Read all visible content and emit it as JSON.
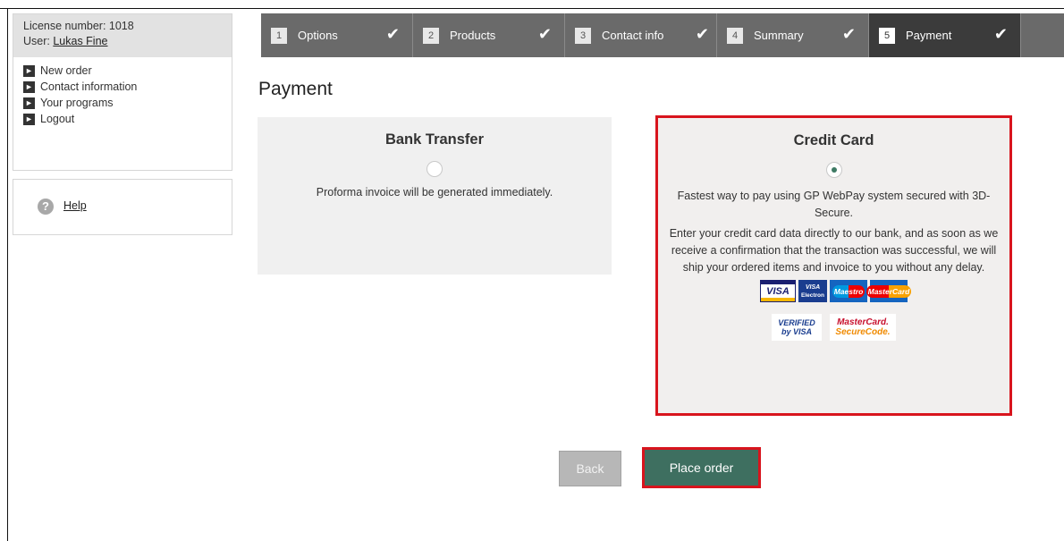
{
  "account": {
    "license_line": "License number: 1018",
    "user_prefix": "User: ",
    "user_name": "Lukas Fine"
  },
  "menu": {
    "items": [
      {
        "label": "New order"
      },
      {
        "label": "Contact information"
      },
      {
        "label": "Your programs"
      },
      {
        "label": "Logout"
      }
    ]
  },
  "help": {
    "label": "Help"
  },
  "steps": [
    {
      "num": "1",
      "label": "Options"
    },
    {
      "num": "2",
      "label": "Products"
    },
    {
      "num": "3",
      "label": "Contact info"
    },
    {
      "num": "4",
      "label": "Summary"
    },
    {
      "num": "5",
      "label": "Payment"
    }
  ],
  "page": {
    "title": "Payment"
  },
  "bank": {
    "title": "Bank Transfer",
    "description": "Proforma invoice will be generated immediately.",
    "selected": false
  },
  "card": {
    "title": "Credit Card",
    "description_1": "Fastest way to pay using GP WebPay system secured with 3D-Secure.",
    "description_2": "Enter your credit card data directly to our bank, and as soon as we receive a confirmation that the transaction was successful, we will ship your ordered items and invoice to you without any delay.",
    "selected": true,
    "logos": {
      "visa": "VISA",
      "visa_electron_1": "VISA",
      "visa_electron_2": "Electron",
      "maestro": "Maestro",
      "mastercard": "MasterCard",
      "vbv_1": "VERIFIED",
      "vbv_2": "by VISA",
      "mcsc_1": "MasterCard.",
      "mcsc_2": "SecureCode."
    }
  },
  "buttons": {
    "back": "Back",
    "place_order": "Place order"
  },
  "colors": {
    "highlight": "#d8141d",
    "primary_button": "#3e6f60",
    "steps_bar": "#6a6a6a",
    "steps_active": "#3b3b3b"
  }
}
